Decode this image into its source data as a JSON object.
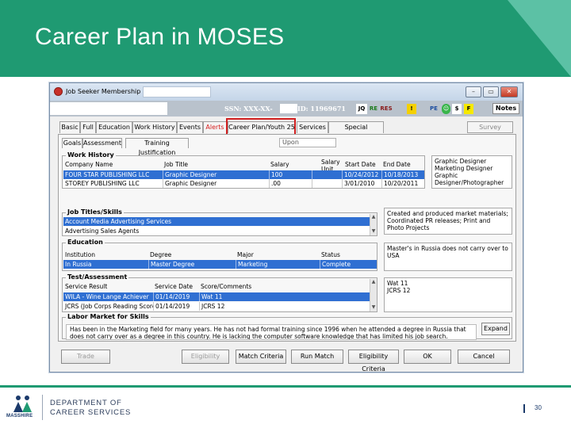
{
  "slide": {
    "title": "Career Plan in MOSES",
    "page_number": "30"
  },
  "window": {
    "title": "Job Seeker Membership",
    "ssn_label": "SSN:  XXX-XX-",
    "id_label": "ID: 11969671",
    "toolbar_icons": [
      "JQ",
      "RE",
      "RES",
      "!",
      "PE",
      "$",
      "F"
    ],
    "notes_label": "Notes"
  },
  "tabs": [
    "Basic",
    "Full",
    "Education",
    "Work History",
    "Events",
    "Alerts",
    "Career Plan/Youth 25",
    "Services",
    "Special Programs"
  ],
  "survey_label": "Survey",
  "subtabs": [
    "Goals",
    "Assessment",
    "Training Justification"
  ],
  "upon_placeholder": "Upon",
  "work_history": {
    "label": "Work History",
    "headers": [
      "Company Name",
      "Job Title",
      "Salary",
      "Salary Unit",
      "Start Date",
      "End Date"
    ],
    "rows": [
      [
        "FOUR STAR PUBLISHING LLC",
        "Graphic Designer",
        "100",
        "",
        "10/24/2012",
        "10/18/2013"
      ],
      [
        "STOREY PUBLISHING LLC",
        "Graphic Designer",
        ".00",
        "",
        "3/01/2010",
        "10/20/2011"
      ]
    ],
    "side_text": "Graphic Designer\nMarketing Designer\nGraphic Designer/Photographer"
  },
  "job_titles": {
    "label": "Job Titles/Skills",
    "rows": [
      "Account Media Advertising Services",
      "Advertising Sales Agents"
    ],
    "side_text": "Created and produced market materials; Coordinated PR releases; Print and Photo Projects"
  },
  "education": {
    "label": "Education",
    "headers": [
      "Institution",
      "Degree",
      "Major",
      "Status"
    ],
    "rows": [
      [
        "In Russia",
        "Master Degree",
        "Marketing",
        "Complete"
      ]
    ],
    "side_text": "Master's in Russia does not carry over to USA"
  },
  "test_assessment": {
    "label": "Test/Assessment",
    "headers": [
      "Service Result",
      "Service Date",
      "Score/Comments"
    ],
    "rows": [
      [
        "WILA - Wine Lange Achiever",
        "01/14/2019",
        "Wat 11"
      ],
      [
        "JCRS (Job Corps Reading Score",
        "01/14/2019",
        "JCRS 12"
      ]
    ],
    "side_text": "Wat 11\nJCRS 12"
  },
  "labor_market": {
    "label": "Labor Market for Skills",
    "text": "Has been in the Marketing field for many years. He has not had formal training since 1996 when he attended a degree in Russia that does not carry over as a degree in this country. He is lacking the computer software knowledge that has limited his job search.",
    "expand_label": "Expand"
  },
  "bottom_buttons": [
    {
      "label": "Trade",
      "enabled": false
    },
    {
      "label": "Eligibility",
      "enabled": false
    },
    {
      "label": "Match Criteria",
      "enabled": true
    },
    {
      "label": "Run Match",
      "enabled": true
    },
    {
      "label": "Eligibility Criteria",
      "enabled": true
    },
    {
      "label": "OK",
      "enabled": true
    },
    {
      "label": "Cancel",
      "enabled": true
    }
  ],
  "footer": {
    "logo_text": "MASSHIRE",
    "dept_line1": "DEPARTMENT OF",
    "dept_line2": "CAREER SERVICES"
  },
  "colors": {
    "header_green": "#1f9a72",
    "selection_blue": "#2f6fd2",
    "highlight_red": "#d11f1f",
    "navy": "#1b3a6b"
  }
}
